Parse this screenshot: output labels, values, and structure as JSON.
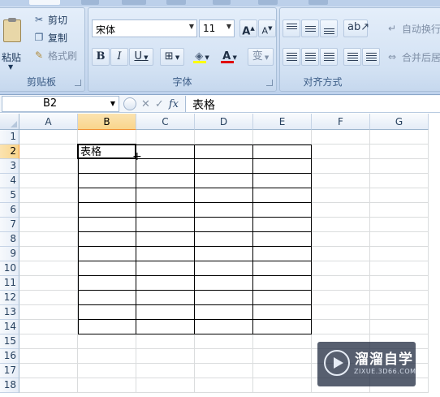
{
  "ribbon": {
    "clipboard": {
      "paste_label": "粘贴",
      "cut_label": "剪切",
      "copy_label": "复制",
      "format_painter_label": "格式刷",
      "group_label": "剪贴板"
    },
    "font": {
      "font_name": "宋体",
      "font_size": "11",
      "grow_label": "A",
      "shrink_label": "A",
      "bold_label": "B",
      "italic_label": "I",
      "underline_label": "U",
      "font_color_label": "A",
      "phonetic_label": "变",
      "group_label": "字体"
    },
    "alignment": {
      "wrap_text_label": "自动换行",
      "merge_center_label": "合并后居",
      "group_label": "对齐方式"
    }
  },
  "formula_bar": {
    "name_box": "B2",
    "fx_label": "fx",
    "formula_value": "表格"
  },
  "grid": {
    "columns": [
      "A",
      "B",
      "C",
      "D",
      "E",
      "F",
      "G"
    ],
    "rows": [
      "1",
      "2",
      "3",
      "4",
      "5",
      "6",
      "7",
      "8",
      "9",
      "10",
      "11",
      "12",
      "13",
      "14",
      "15",
      "16",
      "17",
      "18"
    ],
    "active_cell": "B2",
    "cells": {
      "B2": "表格"
    }
  },
  "watermark": {
    "title": "溜溜自学",
    "url": "ZIXUE.3D66.COM"
  }
}
